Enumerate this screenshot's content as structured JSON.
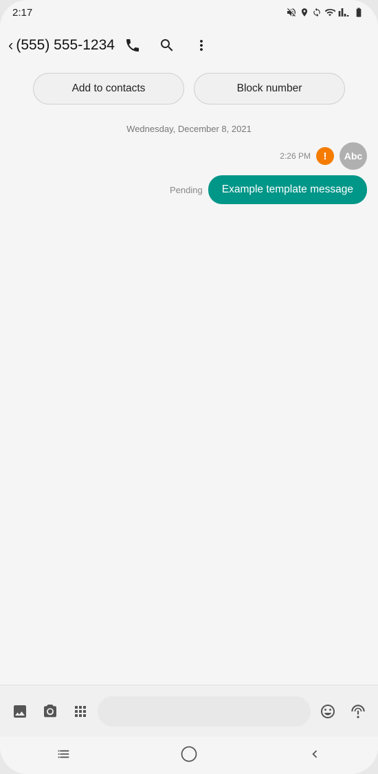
{
  "statusBar": {
    "time": "2:17",
    "icons": [
      "notification-muted",
      "location",
      "sync",
      "wifi",
      "signal",
      "battery"
    ]
  },
  "appBar": {
    "backLabel": "<",
    "phoneNumber": "(555) 555-1234",
    "callIcon": "phone",
    "searchIcon": "search",
    "moreIcon": "more-vert"
  },
  "actionButtons": {
    "addToContacts": "Add to contacts",
    "blockNumber": "Block number"
  },
  "messages": {
    "dateDivider": "Wednesday, December 8, 2021",
    "sentMessage": {
      "time": "2:26 PM",
      "hasError": true,
      "avatarText": "Abc",
      "pendingLabel": "Pending",
      "text": "Example template message"
    }
  },
  "bottomToolbar": {
    "galleryIcon": "image",
    "cameraIcon": "camera",
    "appIcon": "apps",
    "inputPlaceholder": "",
    "emojiIcon": "emoji",
    "voiceIcon": "voice"
  },
  "navBar": {
    "recentAppsIcon": "recent-apps",
    "homeIcon": "home",
    "backIcon": "back"
  }
}
